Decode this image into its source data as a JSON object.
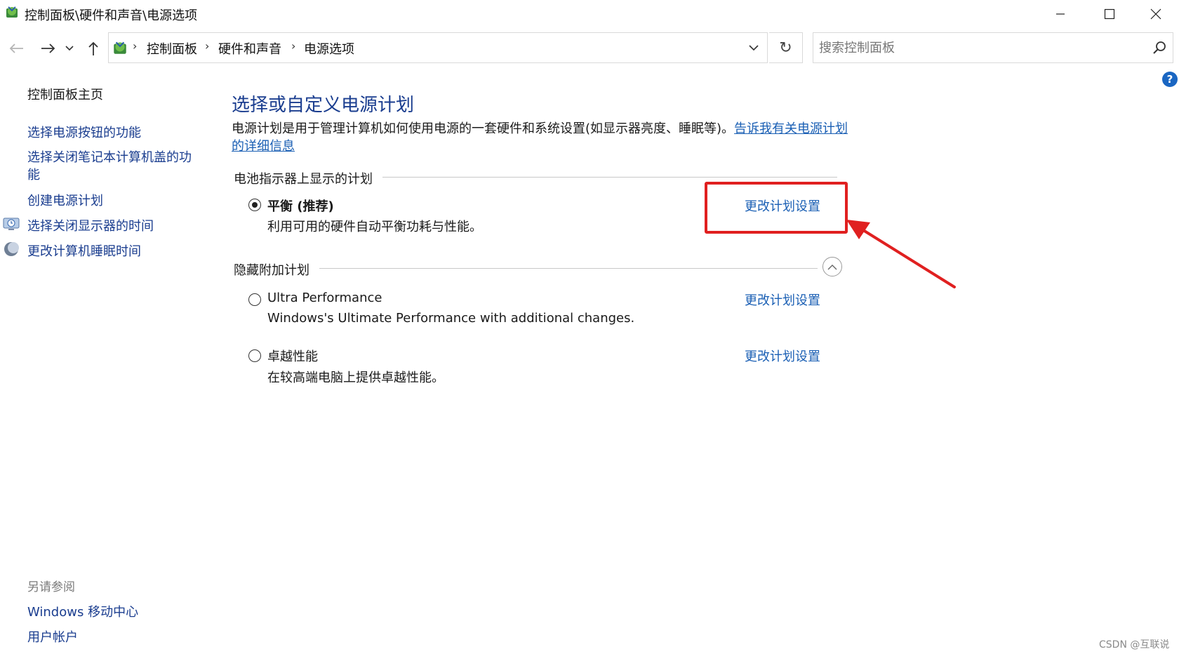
{
  "window": {
    "title": "控制面板\\硬件和声音\\电源选项"
  },
  "nav": {
    "breadcrumbs": [
      "控制面板",
      "硬件和声音",
      "电源选项"
    ],
    "refresh_glyph": "↻",
    "search_placeholder": "搜索控制面板"
  },
  "sidebar": {
    "home": "控制面板主页",
    "links": [
      "选择电源按钮的功能",
      "选择关闭笔记本计算机盖的功能",
      "创建电源计划",
      "选择关闭显示器的时间",
      "更改计算机睡眠时间"
    ],
    "see_also_title": "另请参阅",
    "see_also": [
      "Windows 移动中心",
      "用户帐户"
    ]
  },
  "main": {
    "heading": "选择或自定义电源计划",
    "intro_text": "电源计划是用于管理计算机如何使用电源的一套硬件和系统设置(如显示器亮度、睡眠等)。",
    "intro_link": "告诉我有关电源计划的详细信息",
    "battery_section": "电池指示器上显示的计划",
    "hidden_section": "隐藏附加计划",
    "plans": [
      {
        "name": "平衡 (推荐)",
        "desc": "利用可用的硬件自动平衡功耗与性能。",
        "selected": true,
        "link": "更改计划设置"
      },
      {
        "name": "Ultra Performance",
        "desc": "Windows's Ultimate Performance with additional changes.",
        "selected": false,
        "link": "更改计划设置"
      },
      {
        "name": "卓越性能",
        "desc": "在较高端电脑上提供卓越性能。",
        "selected": false,
        "link": "更改计划设置"
      }
    ]
  },
  "watermark": "CSDN @互联说",
  "colors": {
    "link": "#1a5fb4",
    "heading": "#1a3d8f",
    "annotation": "#e02020",
    "help": "#1a66c2"
  }
}
